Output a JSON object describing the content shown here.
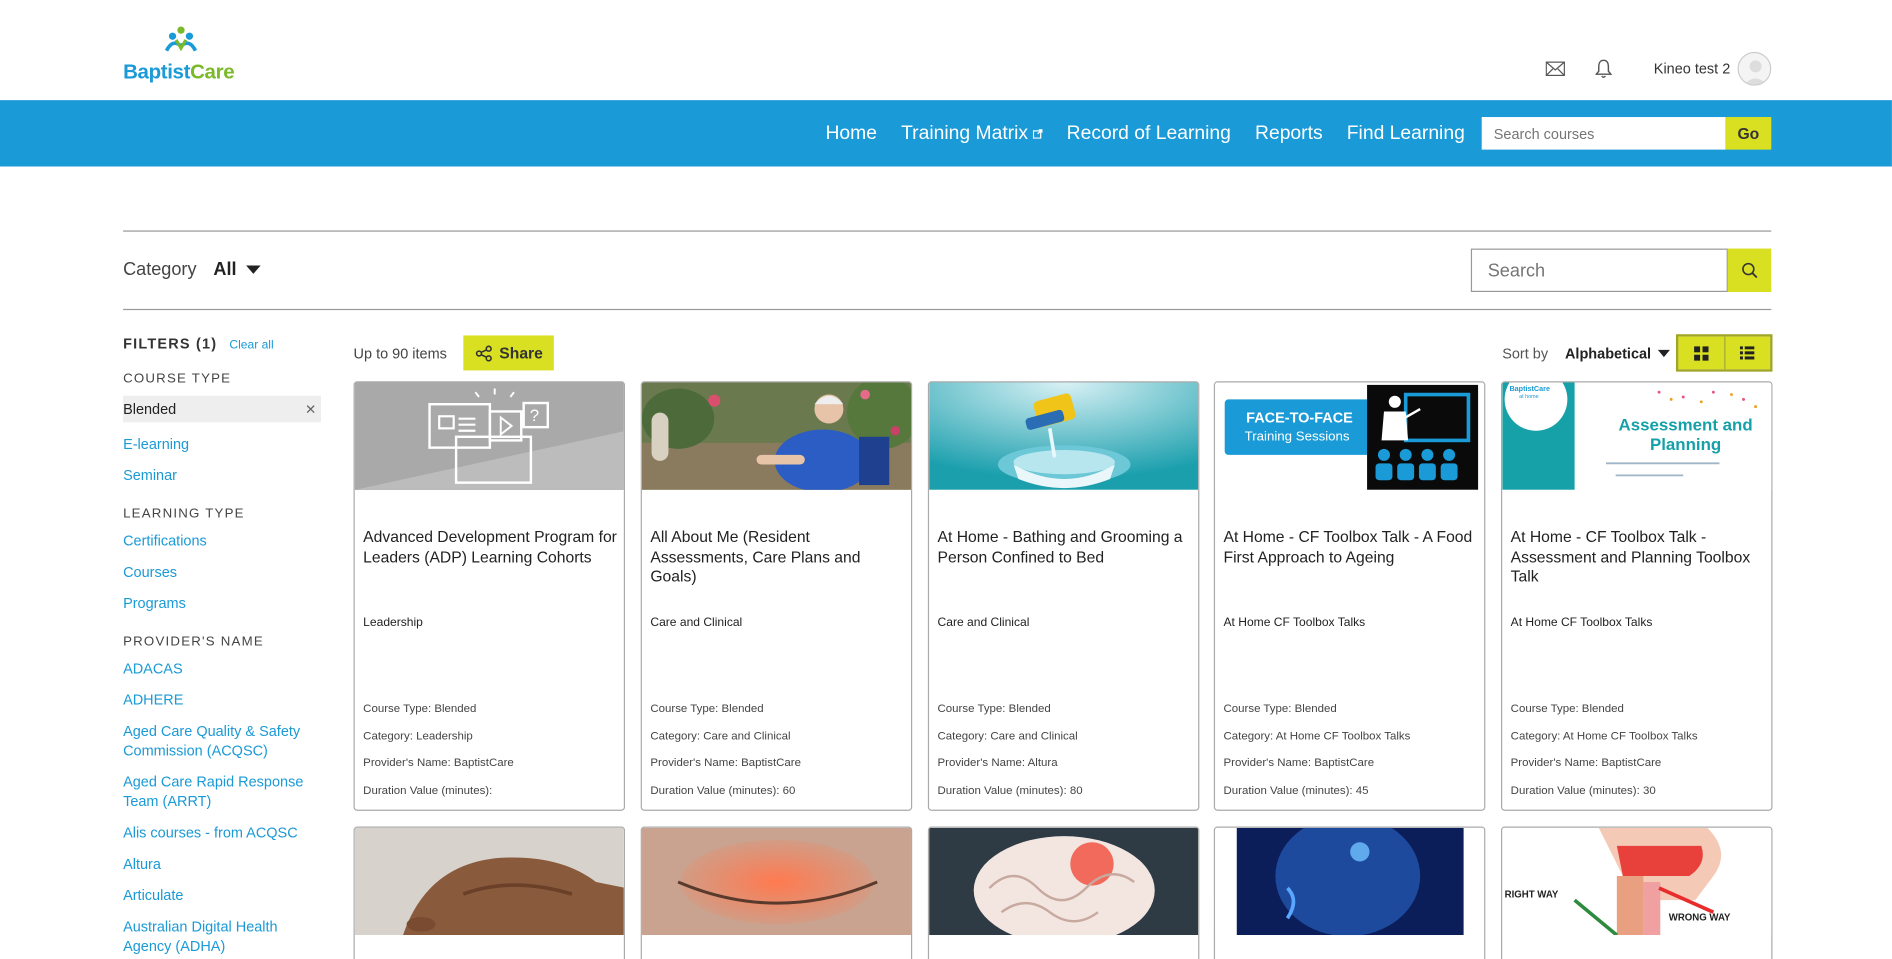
{
  "brand": {
    "part1": "Baptist",
    "part2": "Care"
  },
  "user": {
    "name": "Kineo test 2"
  },
  "nav": {
    "items": [
      "Home",
      "Training Matrix",
      "Record of Learning",
      "Reports",
      "Find Learning"
    ],
    "search_placeholder": "Search courses",
    "go_label": "Go"
  },
  "filterbar": {
    "category_label": "Category",
    "category_value": "All",
    "search_placeholder": "Search"
  },
  "sidebar": {
    "filters_title": "FILTERS (1)",
    "clear_all": "Clear all",
    "course_type_title": "COURSE TYPE",
    "active_filter": "Blended",
    "course_types": [
      "E-learning",
      "Seminar"
    ],
    "learning_type_title": "LEARNING TYPE",
    "learning_types": [
      "Certifications",
      "Courses",
      "Programs"
    ],
    "provider_title": "PROVIDER'S NAME",
    "providers": [
      "ADACAS",
      "ADHERE",
      "Aged Care Quality & Safety Commission (ACQSC)",
      "Aged Care Rapid Response Team (ARRT)",
      "Alis courses - from ACQSC",
      "Altura",
      "Articulate",
      "Australian Digital Health Agency (ADHA)"
    ]
  },
  "results": {
    "count": "Up to 90 items",
    "share": "Share",
    "sort_label": "Sort by",
    "sort_value": "Alphabetical"
  },
  "cards": [
    {
      "title": "Advanced Development Program for Leaders (ADP) Learning Cohorts",
      "category": "Leadership",
      "course_type": "Course Type: Blended",
      "category_meta": "Category: Leadership",
      "provider": "Provider's Name: BaptistCare",
      "duration": "Duration Value (minutes):"
    },
    {
      "title": "All About Me (Resident Assessments, Care Plans and Goals)",
      "category": "Care and Clinical",
      "course_type": "Course Type: Blended",
      "category_meta": "Category: Care and Clinical",
      "provider": "Provider's Name: BaptistCare",
      "duration": "Duration Value (minutes): 60"
    },
    {
      "title": "At Home - Bathing and Grooming a Person Confined to Bed",
      "category": "Care and Clinical",
      "course_type": "Course Type: Blended",
      "category_meta": "Category: Care and Clinical",
      "provider": "Provider's Name: Altura",
      "duration": "Duration Value (minutes): 80"
    },
    {
      "title": "At Home - CF Toolbox Talk - A Food First Approach to Ageing",
      "category": "At Home CF Toolbox Talks",
      "course_type": "Course Type: Blended",
      "category_meta": "Category: At Home CF Toolbox Talks",
      "provider": "Provider's Name: BaptistCare",
      "duration": "Duration Value (minutes): 45"
    },
    {
      "title": "At Home - CF Toolbox Talk - Assessment and Planning Toolbox Talk",
      "category": "At Home CF Toolbox Talks",
      "course_type": "Course Type: Blended",
      "category_meta": "Category: At Home CF Toolbox Talks",
      "provider": "Provider's Name: BaptistCare",
      "duration": "Duration Value (minutes): 30"
    }
  ],
  "thumb_text": {
    "f2f_line1": "FACE-TO-FACE",
    "f2f_line2": "Training Sessions",
    "ap_line1": "Assessment and",
    "ap_line2": "Planning",
    "ap_brand": "BaptistCare",
    "ap_sub": "at home",
    "right_way": "RIGHT WAY",
    "wrong_way": "WRONG WAY"
  }
}
